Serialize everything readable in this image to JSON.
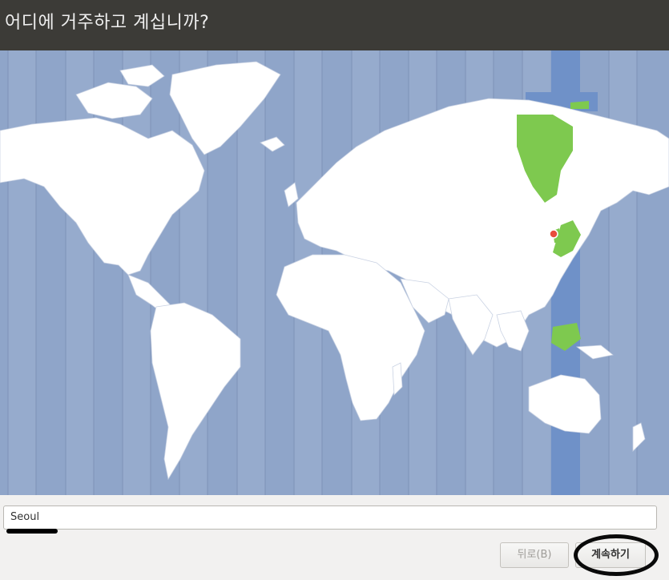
{
  "window": {
    "title": "어디에 거주하고 계십니까?"
  },
  "map": {
    "selected_city": "Seoul",
    "colors": {
      "ocean": "#8fa5c9",
      "land": "#ffffff",
      "selected_zone_band": "#6f91c8",
      "selected_zone_land": "#7ec94f",
      "pin": "#e84c3d"
    }
  },
  "timezone_field": {
    "value": "Seoul"
  },
  "buttons": {
    "back_label": "뒤로(B)",
    "continue_label": "계속하기"
  }
}
